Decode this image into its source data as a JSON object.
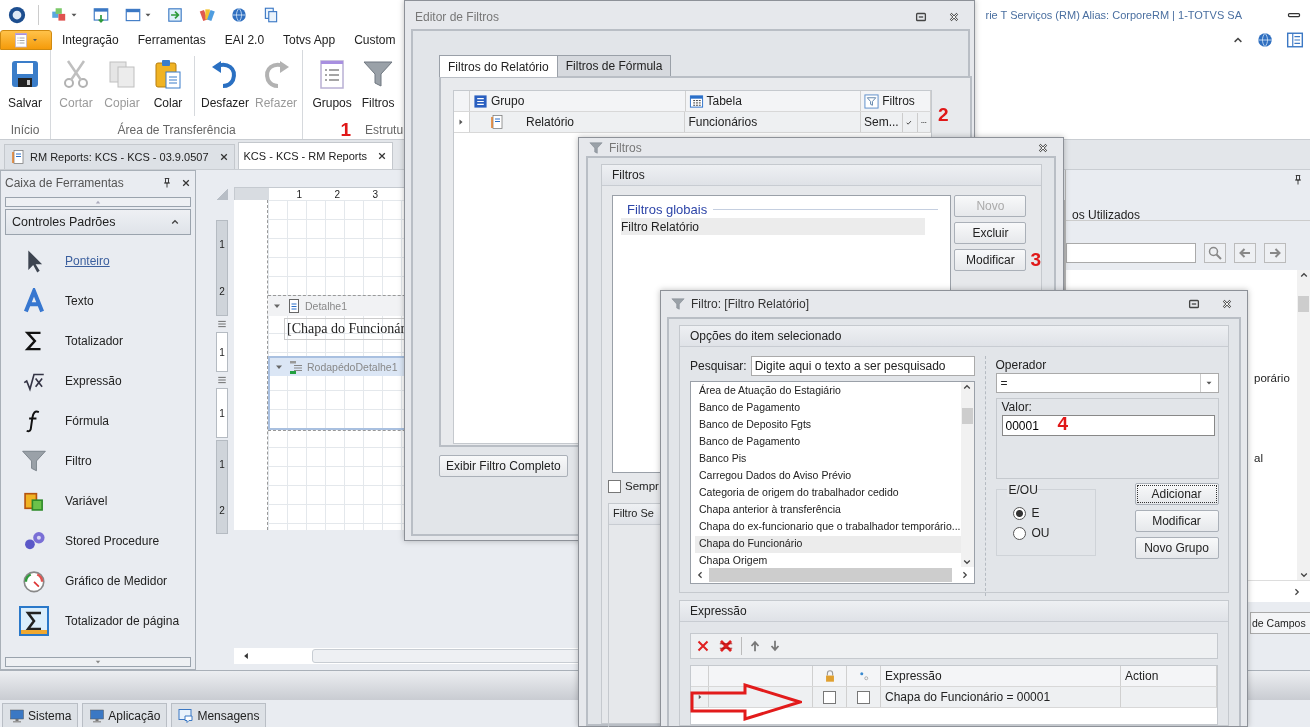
{
  "app": {
    "title": "rie T Serviços (RM) Alias: CorporeRM | 1-TOTVS SA"
  },
  "ribbon": {
    "tabs": [
      {
        "label": "Integração",
        "selected": false
      },
      {
        "label": "Ferramentas",
        "selected": false
      },
      {
        "label": "EAI 2.0",
        "selected": false
      },
      {
        "label": "Totvs App",
        "selected": false
      },
      {
        "label": "Custom",
        "selected": false
      }
    ],
    "groups": [
      {
        "label": "Início",
        "buttons": [
          {
            "label": "Salvar",
            "disabled": false
          }
        ]
      },
      {
        "label": "Área de Transferência",
        "buttons": [
          {
            "label": "Cortar",
            "disabled": true
          },
          {
            "label": "Copiar",
            "disabled": true
          },
          {
            "label": "Colar",
            "disabled": false
          },
          {
            "label": "Desfazer",
            "disabled": false
          },
          {
            "label": "Refazer",
            "disabled": true
          }
        ]
      },
      {
        "label": "Estrutu",
        "marker": "1",
        "buttons": [
          {
            "label": "Grupos",
            "disabled": false
          },
          {
            "label": "Filtros",
            "disabled": false
          }
        ]
      }
    ]
  },
  "document_tabs": [
    {
      "label": "RM Reports: KCS - KCS - 03.9.0507",
      "selected": false
    },
    {
      "label": "KCS - KCS - RM Reports",
      "selected": true
    }
  ],
  "toolbox": {
    "title": "Caixa de Ferramentas",
    "section": {
      "label": "Controles Padrões",
      "expanded": true
    },
    "items": [
      {
        "label": "Ponteiro",
        "selected": true
      },
      {
        "label": "Texto",
        "selected": false
      },
      {
        "label": "Totalizador",
        "selected": false
      },
      {
        "label": "Expressão",
        "selected": false
      },
      {
        "label": "Fórmula",
        "selected": false
      },
      {
        "label": "Filtro",
        "selected": false
      },
      {
        "label": "Variável",
        "selected": false
      },
      {
        "label": "Stored Procedure",
        "selected": false
      },
      {
        "label": "Gráfico de Medidor",
        "selected": false
      },
      {
        "label": "Totalizador de página",
        "selected": false
      }
    ]
  },
  "designer": {
    "ruler": [
      "1",
      "2",
      "3"
    ],
    "vertical_ruler": [
      [
        "1",
        "2"
      ],
      [
        "1"
      ],
      [
        "1"
      ],
      [
        "1",
        "2"
      ]
    ],
    "bands": [
      {
        "label": "Detalhe1",
        "kind": "detail",
        "selected": false,
        "field": "[Chapa do Funcionár"
      },
      {
        "label": "RodapédoDetalhe1",
        "kind": "footer",
        "selected": true
      }
    ]
  },
  "side_panel": {
    "heading": "os Utilizados",
    "items": [
      "porário",
      "al"
    ],
    "footer_tab": "de Campos"
  },
  "bottom_tabs": [
    {
      "label": "Sistema",
      "selected": false
    },
    {
      "label": "Aplicação",
      "selected": false
    },
    {
      "label": "Mensagens",
      "selected": false
    }
  ],
  "editor_window": {
    "title": "Editor de Filtros",
    "tabs": [
      {
        "label": "Filtros do Relatório",
        "selected": true
      },
      {
        "label": "Filtros de Fórmula",
        "selected": false
      }
    ],
    "columns": [
      "Grupo",
      "Tabela",
      "Filtros"
    ],
    "rows": [
      {
        "grupo": "Relatório",
        "tabela": "Funcionários",
        "filtros": "Sem..."
      }
    ],
    "marker": "2",
    "button": "Exibir Filtro Completo"
  },
  "filters_window": {
    "title": "Filtros",
    "group": "Filtros",
    "list_heading": "Filtros globais",
    "items": [
      {
        "label": "Filtro Relatório",
        "selected": true
      }
    ],
    "buttons": [
      {
        "label": "Novo",
        "disabled": true
      },
      {
        "label": "Excluir",
        "disabled": false
      },
      {
        "label": "Modificar",
        "disabled": false
      }
    ],
    "marker": "3",
    "checkbox": {
      "label": "Sempr",
      "checked": false
    },
    "group2": "Filtro Se"
  },
  "filter_window": {
    "title": "Filtro: [Filtro Relatório]",
    "options_title": "Opções do item selecionado",
    "search_label": "Pesquisar:",
    "search_placeholder": "Digite aqui o texto a ser pesquisado",
    "fields": [
      {
        "label": "Área de Atuação do Estagiário",
        "selected": false
      },
      {
        "label": "Banco de  Pagamento",
        "selected": false
      },
      {
        "label": "Banco de Deposito Fgts",
        "selected": false
      },
      {
        "label": "Banco de Pagamento",
        "selected": false
      },
      {
        "label": "Banco Pis",
        "selected": false
      },
      {
        "label": "Carregou Dados do Aviso Prévio",
        "selected": false
      },
      {
        "label": "Categoria de origem do trabalhador cedido",
        "selected": false
      },
      {
        "label": "Chapa anterior à transferência",
        "selected": false
      },
      {
        "label": "Chapa do ex-funcionario que o trabalhador temporário...",
        "selected": false
      },
      {
        "label": "Chapa do Funcionário",
        "selected": true
      },
      {
        "label": "Chapa Origem",
        "selected": false
      }
    ],
    "operator_label": "Operador",
    "operator": "=",
    "value_label": "Valor:",
    "value": "00001",
    "marker": "4",
    "logic_label": "E/OU",
    "logic": [
      {
        "label": "E",
        "selected": true
      },
      {
        "label": "OU",
        "selected": false
      }
    ],
    "buttons": [
      {
        "label": "Adicionar",
        "focused": true
      },
      {
        "label": "Modificar",
        "focused": false
      },
      {
        "label": "Novo Grupo",
        "focused": false
      }
    ],
    "expression_title": "Expressão",
    "columns": [
      "Expressão",
      "Action"
    ],
    "rows": [
      {
        "locked": false,
        "linked": false,
        "expression": "Chapa do Funcionário = 00001"
      }
    ]
  }
}
